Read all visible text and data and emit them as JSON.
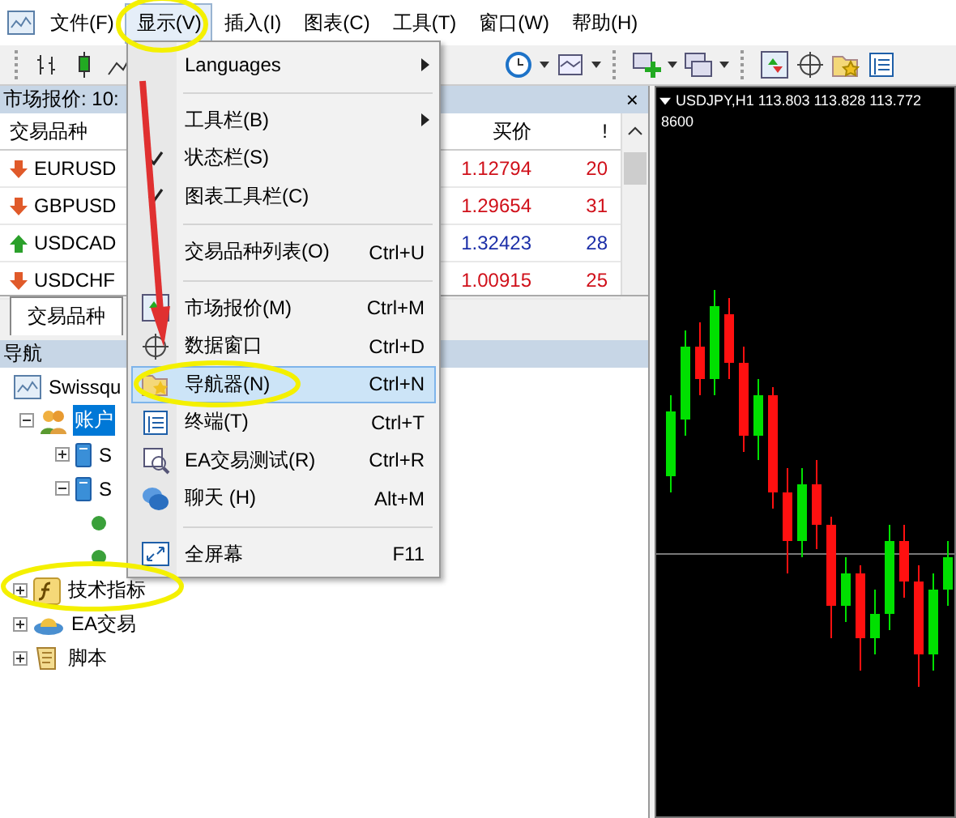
{
  "menubar": {
    "items": [
      {
        "label": "文件(F)",
        "selected": false
      },
      {
        "label": "显示(V)",
        "selected": true
      },
      {
        "label": "插入(I)",
        "selected": false
      },
      {
        "label": "图表(C)",
        "selected": false
      },
      {
        "label": "工具(T)",
        "selected": false
      },
      {
        "label": "窗口(W)",
        "selected": false
      },
      {
        "label": "帮助(H)",
        "selected": false
      }
    ]
  },
  "market_watch": {
    "title": "市场报价: 10:",
    "close": "×",
    "columns": [
      "交易品种",
      "买价",
      "!"
    ],
    "rows": [
      {
        "symbol": "EURUSD",
        "kind": "down",
        "bid": "1.12794",
        "column_3": "20"
      },
      {
        "symbol": "GBPUSD",
        "kind": "down",
        "bid": "1.29654",
        "column_3": "31"
      },
      {
        "symbol": "USDCAD",
        "kind": "up",
        "bid": "1.32423",
        "column_3": "28"
      },
      {
        "symbol": "USDCHF",
        "kind": "down",
        "bid": "1.00915",
        "column_3": "25"
      }
    ],
    "tabs": [
      {
        "label": "交易品种",
        "selected": true
      }
    ]
  },
  "navigator": {
    "title": "导航",
    "tree": [
      {
        "label": "Swissqu",
        "kind": "terminal",
        "children": [
          {
            "label": "账户",
            "kind": "accounts",
            "expanded": true,
            "selected": true,
            "children": [
              {
                "label": "S",
                "kind": "server",
                "expanded": false,
                "selected": false
              },
              {
                "label": "S",
                "kind": "server",
                "expanded": true,
                "selected": false,
                "children": [
                  {
                    "kind": "account"
                  },
                  {
                    "kind": "account"
                  }
                ]
              }
            ]
          }
        ]
      },
      {
        "label": "技术指标",
        "kind": "indicators",
        "expanded": false,
        "selected": false
      },
      {
        "label": "EA交易",
        "kind": "experts",
        "expanded": false,
        "selected": false
      },
      {
        "label": "脚本",
        "kind": "scripts",
        "expanded": false,
        "selected": false
      }
    ]
  },
  "view_menu": {
    "items": [
      {
        "kind": "submenu",
        "label": "Languages",
        "checked": false,
        "has_icon": false,
        "selected": false
      },
      {
        "kind": "separator"
      },
      {
        "kind": "submenu",
        "label": "工具栏(B)",
        "checked": false,
        "has_icon": false,
        "selected": false
      },
      {
        "kind": "item",
        "label": "状态栏(S)",
        "checked": true,
        "has_icon": false,
        "selected": false
      },
      {
        "kind": "item",
        "label": "图表工具栏(C)",
        "checked": true,
        "has_icon": false,
        "selected": false
      },
      {
        "kind": "separator"
      },
      {
        "kind": "item",
        "label": "交易品种列表(O)",
        "shortcut": "Ctrl+U",
        "checked": false,
        "has_icon": false,
        "selected": false
      },
      {
        "kind": "separator"
      },
      {
        "kind": "item",
        "label": "市场报价(M)",
        "shortcut": "Ctrl+M",
        "checked": false,
        "has_icon": true,
        "selected": false
      },
      {
        "kind": "item",
        "label": "数据窗口",
        "shortcut": "Ctrl+D",
        "checked": false,
        "has_icon": true,
        "selected": false
      },
      {
        "kind": "item",
        "label": "导航器(N)",
        "shortcut": "Ctrl+N",
        "checked": false,
        "has_icon": true,
        "selected": true
      },
      {
        "kind": "item",
        "label": "终端(T)",
        "shortcut": "Ctrl+T",
        "checked": false,
        "has_icon": true,
        "selected": false
      },
      {
        "kind": "item",
        "label": "EA交易测试(R)",
        "shortcut": "Ctrl+R",
        "checked": false,
        "has_icon": true,
        "selected": false
      },
      {
        "kind": "item",
        "label": "聊天 (H)",
        "shortcut": "Alt+M",
        "checked": false,
        "has_icon": true,
        "selected": false
      },
      {
        "kind": "separator"
      },
      {
        "kind": "item",
        "label": "全屏幕",
        "shortcut": "F11",
        "checked": false,
        "has_icon": true,
        "selected": false
      }
    ]
  },
  "chart": {
    "header": "USDJPY,H1  113.803 113.828 113.772",
    "line_2": "8600"
  }
}
